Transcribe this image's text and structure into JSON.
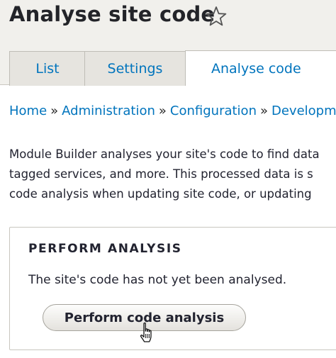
{
  "header": {
    "title": "Analyse site code",
    "tabs": [
      {
        "label": "List"
      },
      {
        "label": "Settings"
      },
      {
        "label": "Analyse code",
        "active": true
      }
    ]
  },
  "breadcrumb": {
    "items": [
      "Home",
      "Administration",
      "Configuration",
      "Developm"
    ],
    "separator": "»"
  },
  "description": {
    "lines": [
      "Module Builder analyses your site's code to find data",
      "tagged services, and more. This processed data is s",
      "code analysis when updating site code, or updating"
    ]
  },
  "panel": {
    "title": "PERFORM ANALYSIS",
    "status_text": "The site's code has not yet been analysed.",
    "button_label": "Perform code analysis"
  },
  "colors": {
    "link": "#0074bd",
    "header_bg": "#f1f0ec",
    "text": "#222330"
  }
}
